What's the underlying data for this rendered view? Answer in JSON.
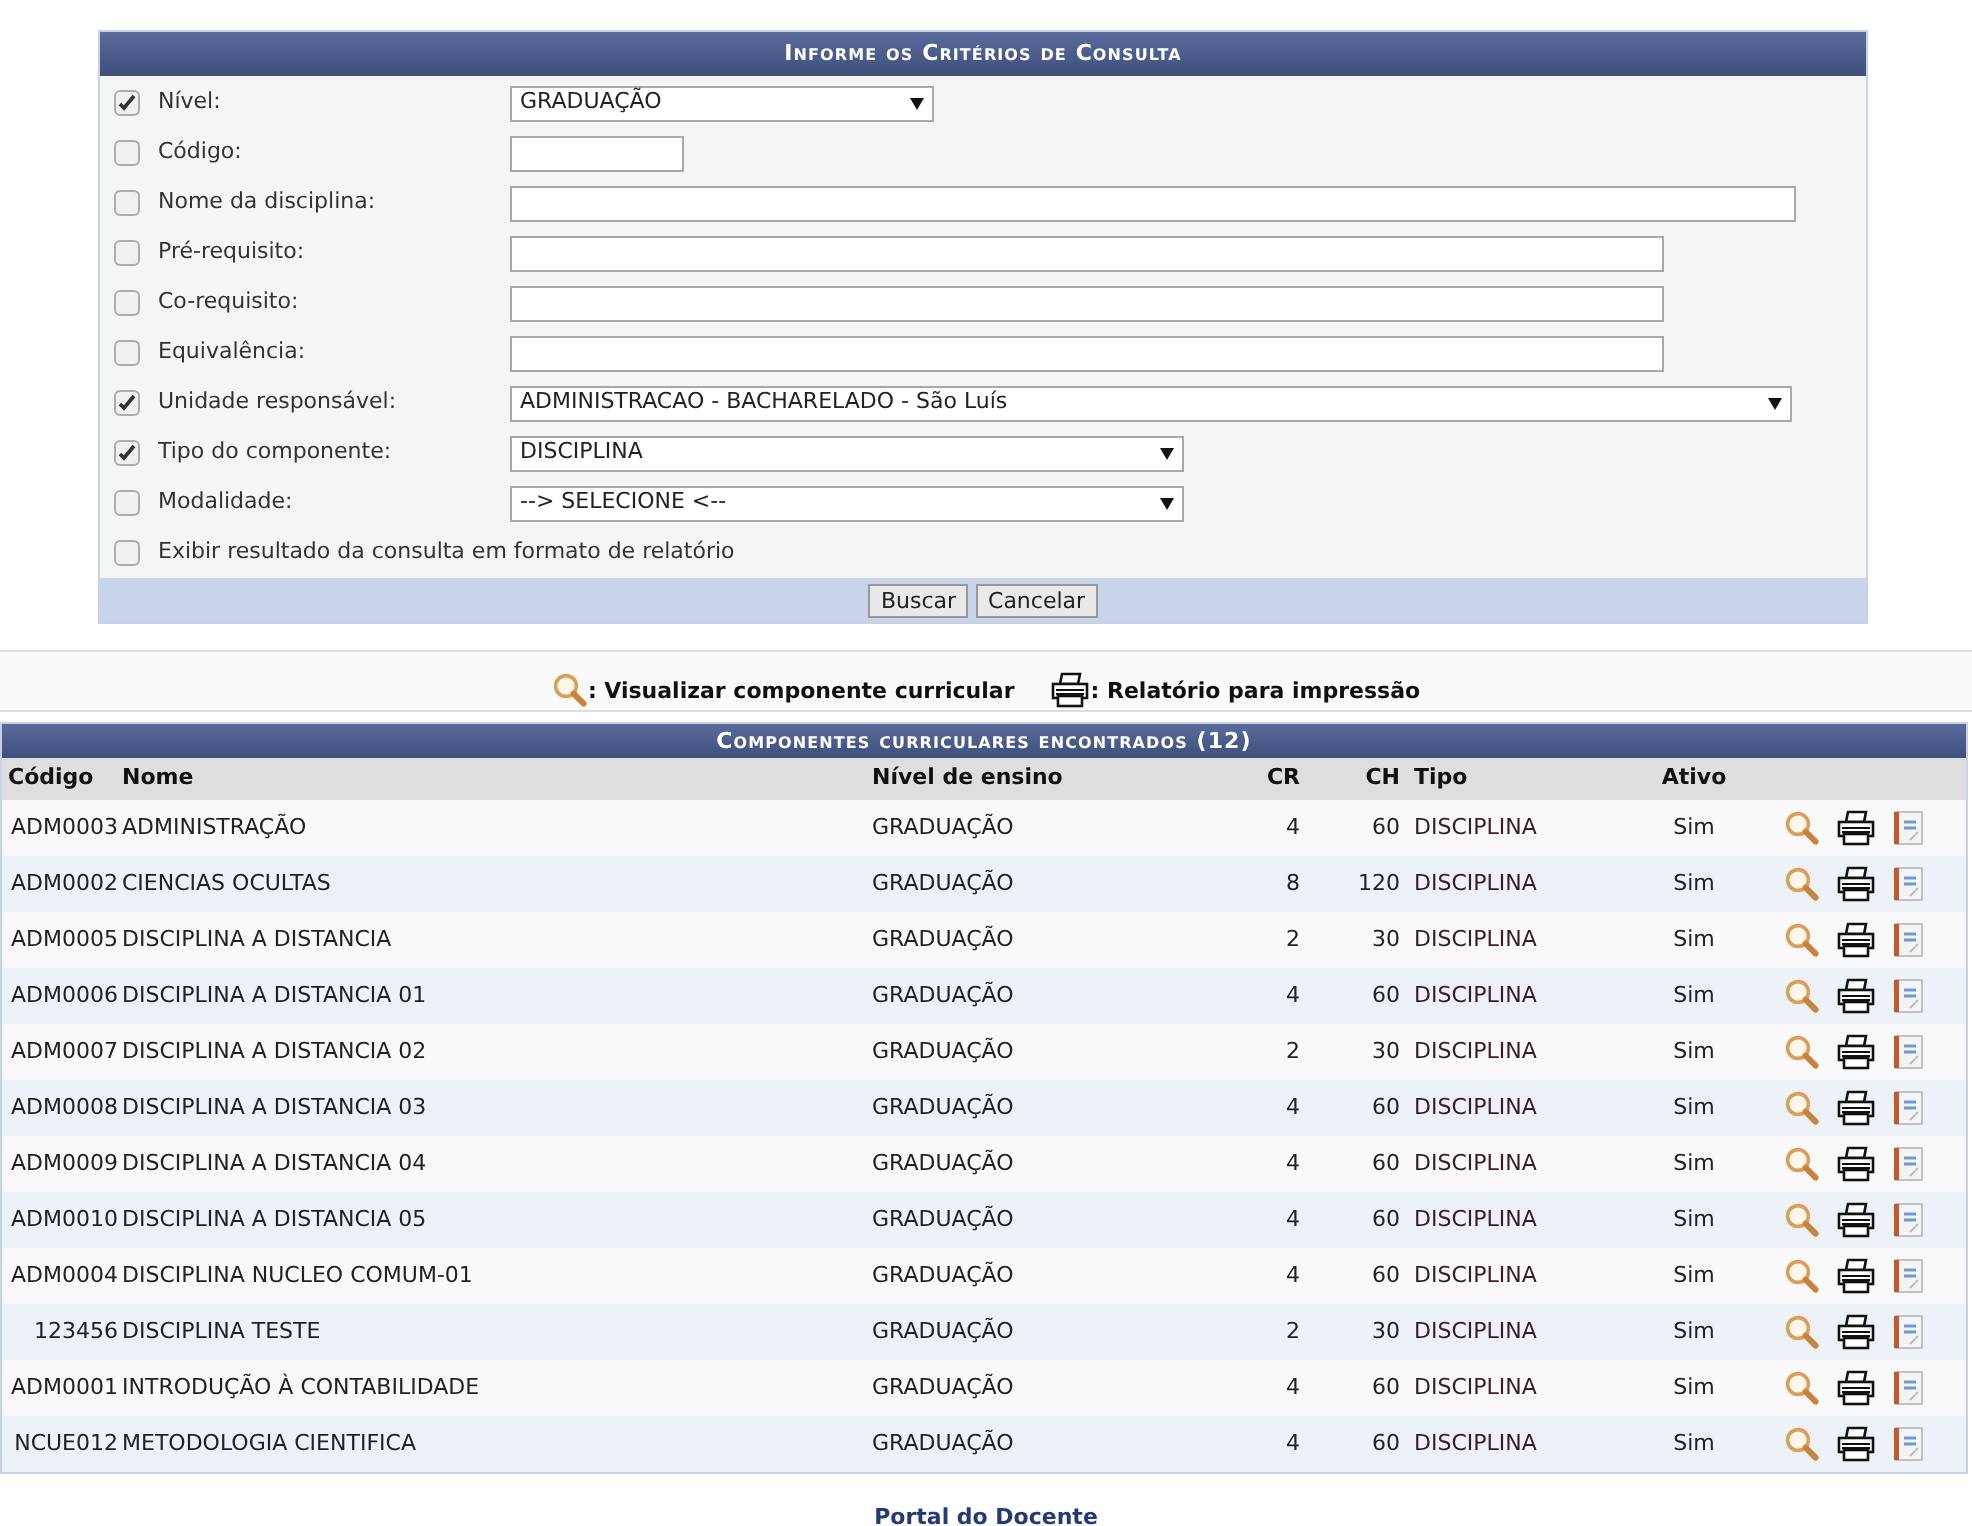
{
  "form": {
    "title": "Informe os Critérios de Consulta",
    "fields": [
      {
        "label": "Nível:",
        "checked": true,
        "kind": "select",
        "value": "GRADUAÇÃO"
      },
      {
        "label": "Código:",
        "checked": false,
        "kind": "text"
      },
      {
        "label": "Nome da disciplina:",
        "checked": false,
        "kind": "text"
      },
      {
        "label": "Pré-requisito:",
        "checked": false,
        "kind": "text"
      },
      {
        "label": "Co-requisito:",
        "checked": false,
        "kind": "text"
      },
      {
        "label": "Equivalência:",
        "checked": false,
        "kind": "text"
      },
      {
        "label": "Unidade responsável:",
        "checked": true,
        "kind": "select",
        "value": "ADMINISTRACAO - BACHARELADO - São Luís"
      },
      {
        "label": "Tipo do componente:",
        "checked": true,
        "kind": "select",
        "value": "DISCIPLINA"
      },
      {
        "label": "Modalidade:",
        "checked": false,
        "kind": "select",
        "value": "--> SELECIONE <--"
      }
    ],
    "report_option": {
      "label": "Exibir resultado da consulta em formato de relatório",
      "checked": false
    },
    "buttons": [
      "Buscar",
      "Cancelar"
    ]
  },
  "legend": [
    {
      "kind": "view",
      "label": ": Visualizar componente curricular"
    },
    {
      "kind": "print",
      "label": ": Relatório para impressão"
    }
  ],
  "table": {
    "title": "Componentes curriculares encontrados (12)",
    "columns": [
      "Código",
      "Nome",
      "Nível de ensino",
      "CR",
      "CH",
      "Tipo",
      "Ativo"
    ],
    "rows": [
      [
        "ADM0003",
        "ADMINISTRAÇÃO",
        "GRADUAÇÃO",
        "4",
        "60",
        "DISCIPLINA",
        "Sim"
      ],
      [
        "ADM0002",
        "CIENCIAS OCULTAS",
        "GRADUAÇÃO",
        "8",
        "120",
        "DISCIPLINA",
        "Sim"
      ],
      [
        "ADM0005",
        "DISCIPLINA A DISTANCIA",
        "GRADUAÇÃO",
        "2",
        "30",
        "DISCIPLINA",
        "Sim"
      ],
      [
        "ADM0006",
        "DISCIPLINA A DISTANCIA 01",
        "GRADUAÇÃO",
        "4",
        "60",
        "DISCIPLINA",
        "Sim"
      ],
      [
        "ADM0007",
        "DISCIPLINA A DISTANCIA 02",
        "GRADUAÇÃO",
        "2",
        "30",
        "DISCIPLINA",
        "Sim"
      ],
      [
        "ADM0008",
        "DISCIPLINA A DISTANCIA 03",
        "GRADUAÇÃO",
        "4",
        "60",
        "DISCIPLINA",
        "Sim"
      ],
      [
        "ADM0009",
        "DISCIPLINA A DISTANCIA 04",
        "GRADUAÇÃO",
        "4",
        "60",
        "DISCIPLINA",
        "Sim"
      ],
      [
        "ADM0010",
        "DISCIPLINA A DISTANCIA 05",
        "GRADUAÇÃO",
        "4",
        "60",
        "DISCIPLINA",
        "Sim"
      ],
      [
        "ADM0004",
        "DISCIPLINA NUCLEO COMUM-01",
        "GRADUAÇÃO",
        "4",
        "60",
        "DISCIPLINA",
        "Sim"
      ],
      [
        "123456",
        "DISCIPLINA TESTE",
        "GRADUAÇÃO",
        "2",
        "30",
        "DISCIPLINA",
        "Sim"
      ],
      [
        "ADM0001",
        "INTRODUÇÃO À CONTABILIDADE",
        "GRADUAÇÃO",
        "4",
        "60",
        "DISCIPLINA",
        "Sim"
      ],
      [
        "NCUE012",
        "METODOLOGIA CIENTIFICA",
        "GRADUAÇÃO",
        "4",
        "60",
        "DISCIPLINA",
        "Sim"
      ]
    ]
  },
  "footer_link": "Portal do Docente"
}
